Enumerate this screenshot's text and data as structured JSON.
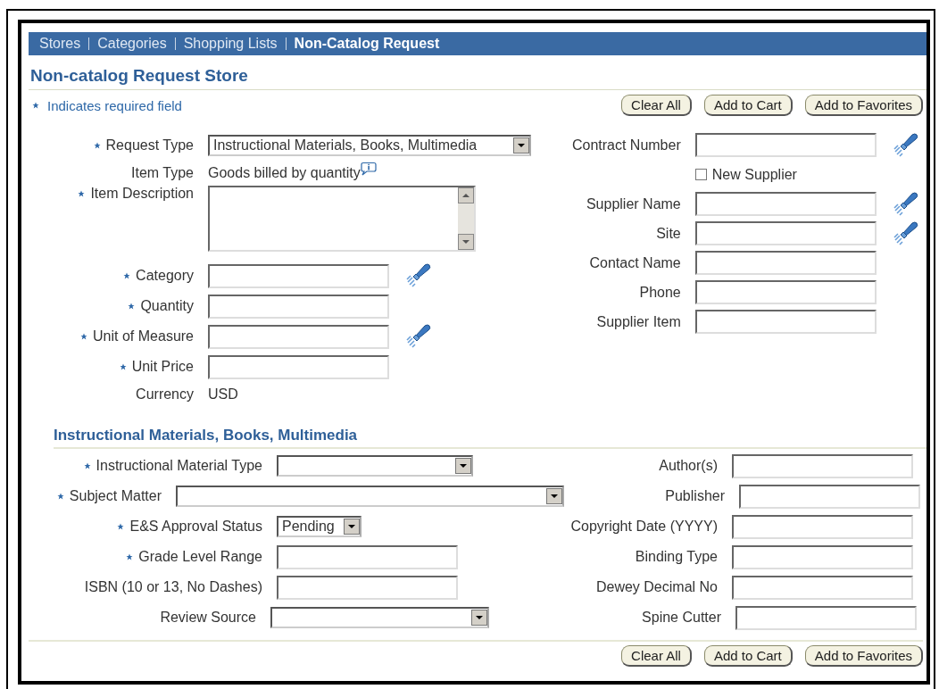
{
  "nav": [
    {
      "label": "Stores",
      "selected": false
    },
    {
      "label": "Categories",
      "selected": false
    },
    {
      "label": "Shopping Lists",
      "selected": false
    },
    {
      "label": "Non-Catalog Request",
      "selected": true
    }
  ],
  "title": "Non-catalog Request Store",
  "required_note": "Indicates required field",
  "buttons_top": [
    "Clear All",
    "Add to Cart",
    "Add to Favorites"
  ],
  "main_left": [
    {
      "kind": "select",
      "label": "Request Type",
      "required": true,
      "value": "Instructional Materials, Books, Multimedia",
      "lookup": false
    },
    {
      "kind": "static",
      "label": "Item Type",
      "required": false,
      "value": "Goods billed by quantity",
      "info": true
    },
    {
      "kind": "textarea",
      "label": "Item Description",
      "required": true
    },
    {
      "kind": "input",
      "label": "Category",
      "required": true,
      "lookup": true
    },
    {
      "kind": "input",
      "label": "Quantity",
      "required": true,
      "lookup": false
    },
    {
      "kind": "input",
      "label": "Unit of Measure",
      "required": true,
      "lookup": true
    },
    {
      "kind": "input",
      "label": "Unit Price",
      "required": true,
      "lookup": false
    },
    {
      "kind": "static",
      "label": "Currency",
      "required": false,
      "value": "USD",
      "info": false
    }
  ],
  "main_right": [
    {
      "kind": "input",
      "label": "Contract Number",
      "required": false,
      "lookup": true
    },
    {
      "kind": "checkbox",
      "label": "New Supplier",
      "checked": false
    },
    {
      "kind": "input",
      "label": "Supplier Name",
      "required": false,
      "lookup": true
    },
    {
      "kind": "input",
      "label": "Site",
      "required": false,
      "lookup": true
    },
    {
      "kind": "input",
      "label": "Contact Name",
      "required": false,
      "lookup": false
    },
    {
      "kind": "input",
      "label": "Phone",
      "required": false,
      "lookup": false
    },
    {
      "kind": "input",
      "label": "Supplier Item",
      "required": false,
      "lookup": false
    }
  ],
  "section_title": "Instructional Materials, Books, Multimedia",
  "section_left": [
    {
      "kind": "select",
      "label": "Instructional Material Type",
      "required": true
    },
    {
      "kind": "select",
      "label": "Subject Matter",
      "required": true
    },
    {
      "kind": "select",
      "label": "E&S Approval Status",
      "required": true,
      "value": "Pending"
    },
    {
      "kind": "input",
      "label": "Grade Level Range",
      "required": true
    },
    {
      "kind": "input",
      "label": "ISBN (10 or 13, No Dashes)",
      "required": false
    },
    {
      "kind": "select",
      "label": "Review Source",
      "required": false
    }
  ],
  "section_right": [
    {
      "kind": "input",
      "label": "Author(s)",
      "required": false
    },
    {
      "kind": "input",
      "label": "Publisher",
      "required": false
    },
    {
      "kind": "input",
      "label": "Copyright Date (YYYY)",
      "required": false
    },
    {
      "kind": "input",
      "label": "Binding Type",
      "required": false
    },
    {
      "kind": "input",
      "label": "Dewey Decimal No",
      "required": false
    },
    {
      "kind": "input",
      "label": "Spine Cutter",
      "required": false
    }
  ],
  "buttons_bottom": [
    "Clear All",
    "Add to Cart",
    "Add to Favorites"
  ]
}
